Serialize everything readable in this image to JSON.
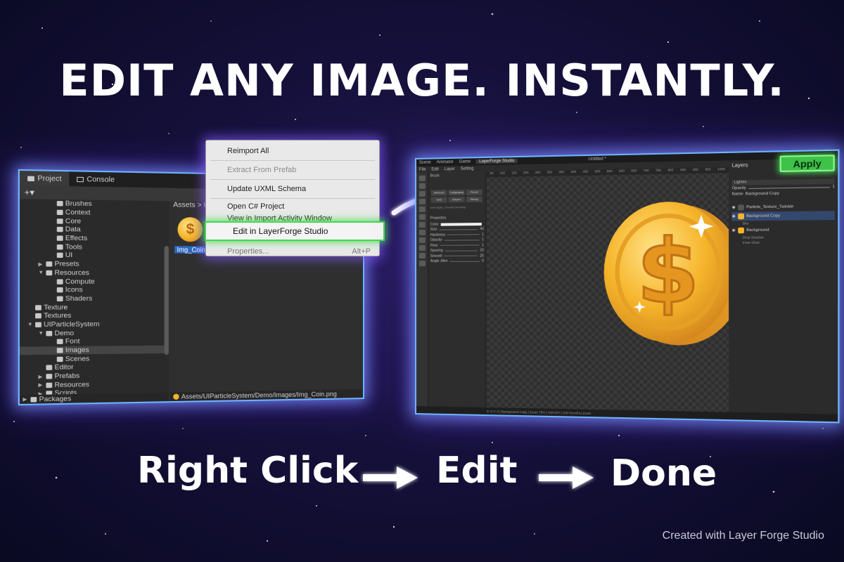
{
  "headline": "EDIT ANY IMAGE. INSTANTLY.",
  "project_window": {
    "tabs": [
      {
        "label": "Project"
      },
      {
        "label": "Console"
      }
    ],
    "add_label": "+▾",
    "tree": [
      {
        "label": "Brushes",
        "indent": 3
      },
      {
        "label": "Context",
        "indent": 3
      },
      {
        "label": "Core",
        "indent": 3
      },
      {
        "label": "Data",
        "indent": 3
      },
      {
        "label": "Effects",
        "indent": 3
      },
      {
        "label": "Tools",
        "indent": 3
      },
      {
        "label": "UI",
        "indent": 3
      },
      {
        "label": "Presets",
        "indent": 2,
        "caret": "▶"
      },
      {
        "label": "Resources",
        "indent": 2,
        "caret": "▼"
      },
      {
        "label": "Compute",
        "indent": 3
      },
      {
        "label": "Icons",
        "indent": 3
      },
      {
        "label": "Shaders",
        "indent": 3
      },
      {
        "label": "Texture",
        "indent": 1
      },
      {
        "label": "Textures",
        "indent": 1
      },
      {
        "label": "UIParticleSystem",
        "indent": 1,
        "caret": "▼"
      },
      {
        "label": "Demo",
        "indent": 2,
        "caret": "▼"
      },
      {
        "label": "Font",
        "indent": 3
      },
      {
        "label": "Images",
        "indent": 3,
        "selected": true
      },
      {
        "label": "Scenes",
        "indent": 3
      },
      {
        "label": "Editor",
        "indent": 2
      },
      {
        "label": "Prefabs",
        "indent": 2,
        "caret": "▶"
      },
      {
        "label": "Resources",
        "indent": 2,
        "caret": "▶"
      },
      {
        "label": "Scripts",
        "indent": 2,
        "caret": "▶"
      }
    ],
    "packages_label": "Packages",
    "breadcrumb": "Assets > U",
    "asset_label": "Img_Coin",
    "status_path": "Assets/UIParticleSystem/Demo/Images/Img_Coin.png"
  },
  "context_menu": {
    "items": [
      {
        "label": "Reimport All",
        "disabled": false
      },
      {
        "label": "Extract From Prefab",
        "disabled": true
      },
      {
        "label": "Update UXML Schema",
        "disabled": false
      },
      {
        "label": "Open C# Project",
        "disabled": false
      },
      {
        "label": "View in Import Activity Window",
        "disabled": false
      }
    ],
    "highlighted": "Edit in LayerForge Studio",
    "properties_label": "Properties...",
    "properties_shortcut": "Alt+P"
  },
  "editor": {
    "tabs": [
      "Scene",
      "Animator",
      "Game",
      "LayerForge Studio"
    ],
    "menu": [
      "File",
      "Edit",
      "Layer",
      "Setting"
    ],
    "canvas_title": "Untitled *",
    "brush_title": "Brush",
    "brush_buttons": [
      "Airbrush",
      "Calligraphy",
      "Pencil",
      "Grid",
      "Inkpen",
      "Stamp"
    ],
    "brush_hint": "soft edges, smooth blending",
    "properties_title": "Properties",
    "properties": [
      {
        "label": "Color",
        "value": ""
      },
      {
        "label": "Size",
        "value": "40"
      },
      {
        "label": "Hardness",
        "value": "1"
      },
      {
        "label": "Opacity",
        "value": "1"
      },
      {
        "label": "Flow",
        "value": "1"
      },
      {
        "label": "Spacing",
        "value": "10"
      },
      {
        "label": "Smooth",
        "value": "25"
      },
      {
        "label": "Angle Jitter",
        "value": "0"
      }
    ],
    "layers_title": "Layers",
    "apply_label": "Apply",
    "blend_mode": "Lighten",
    "opacity_label": "Opacity",
    "opacity_value": "1",
    "name_label": "Name",
    "name_value": "Background Copy",
    "layers": [
      {
        "label": "Particle_Texture_Twinkle",
        "selected": false
      },
      {
        "label": "Background Copy",
        "selected": true
      },
      {
        "label": "Background",
        "selected": false
      }
    ],
    "layer_subs": [
      "Blur",
      "Drop Shadow",
      "Inner Glow"
    ],
    "ruler_ticks": [
      "50",
      "100",
      "150",
      "200",
      "250",
      "300",
      "350",
      "400",
      "450",
      "500",
      "550",
      "600",
      "650",
      "700",
      "750",
      "800",
      "850",
      "900",
      "950",
      "1000"
    ],
    "status_text": "X: 0 Y: 0  |  Background Copy  |  Zoom 75%  |  Ctrl+Z/Y  |  Ctrl+Scroll to Zoom"
  },
  "steps": [
    "Right Click",
    "Edit",
    "Done"
  ],
  "credit": "Created with Layer Forge Studio",
  "colors": {
    "accent_green": "#3ec24a",
    "glow_blue": "#6fb3ff",
    "coin_gold": "#f5b52a"
  }
}
